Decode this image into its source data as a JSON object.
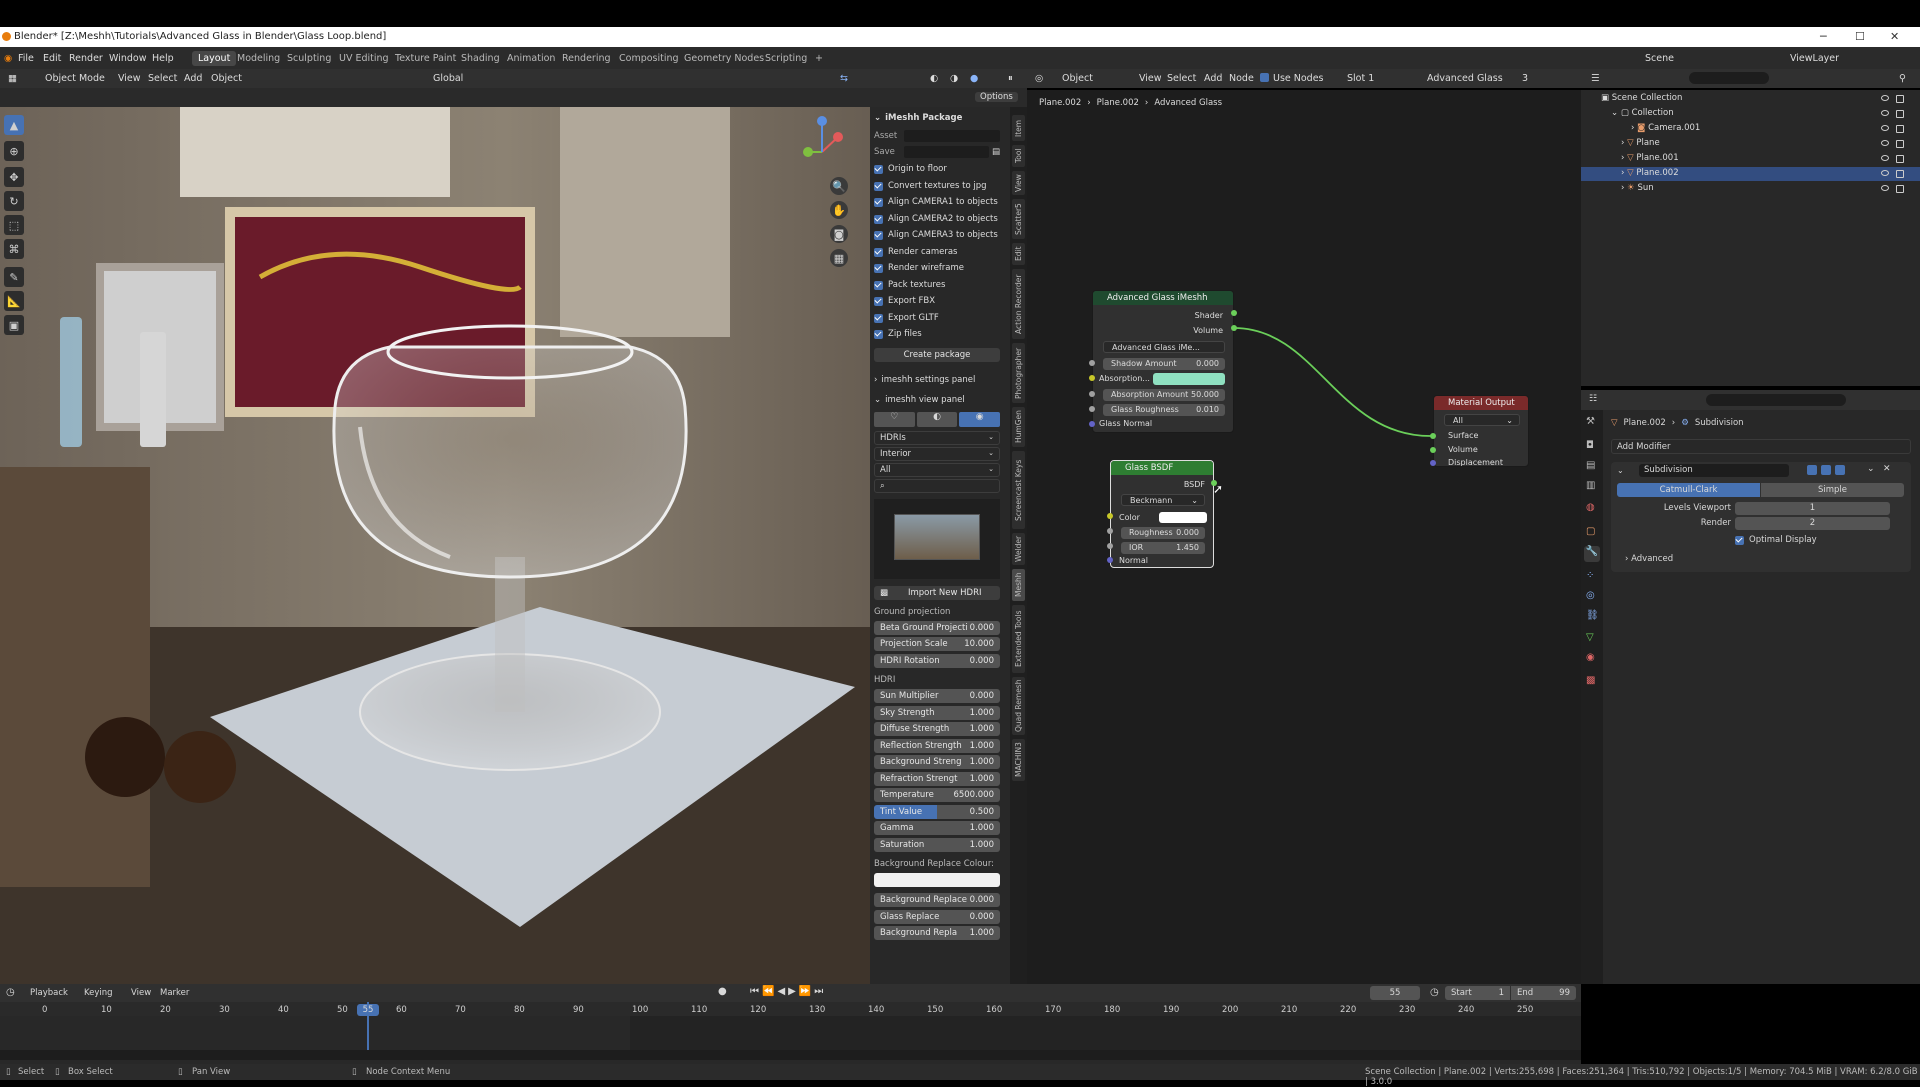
{
  "window": {
    "title": "Blender* [Z:\\Meshh\\Tutorials\\Advanced Glass in Blender\\Glass Loop.blend]"
  },
  "menubar": {
    "menus": [
      "File",
      "Edit",
      "Render",
      "Window",
      "Help"
    ],
    "workspaces": [
      "Layout",
      "Modeling",
      "Sculpting",
      "UV Editing",
      "Texture Paint",
      "Shading",
      "Animation",
      "Rendering",
      "Compositing",
      "Geometry Nodes",
      "Scripting"
    ],
    "add_tab": "+",
    "scene": "Scene",
    "view_layer": "ViewLayer"
  },
  "viewport_header": {
    "mode": "Object Mode",
    "menus": [
      "View",
      "Select",
      "Add",
      "Object"
    ],
    "orientation": "Global",
    "options": "Options"
  },
  "npanel": {
    "package_title": "iMeshh Package",
    "asset_label": "Asset",
    "save_label": "Save",
    "checkboxes": [
      "Origin to floor",
      "Convert textures to jpg",
      "Align CAMERA1 to objects",
      "Align CAMERA2 to objects",
      "Align CAMERA3 to objects",
      "Render cameras",
      "Render wireframe",
      "Pack textures",
      "Export FBX",
      "Export GLTF",
      "Zip files"
    ],
    "create_package": "Create package",
    "settings_panel": "imeshh settings panel",
    "view_panel": "imeshh view panel",
    "dropdowns": [
      "HDRIs",
      "Interior",
      "All"
    ],
    "import_hdri": "Import New HDRI",
    "ground_projection_label": "Ground projection",
    "ground_fields": [
      {
        "label": "Beta Ground Projecti",
        "value": "0.000"
      },
      {
        "label": "Projection Scale",
        "value": "10.000"
      },
      {
        "label": "HDRI Rotation",
        "value": "0.000"
      }
    ],
    "hdri_label": "HDRI",
    "hdri_fields": [
      {
        "label": "Sun Multiplier",
        "value": "0.000"
      },
      {
        "label": "Sky Strength",
        "value": "1.000"
      },
      {
        "label": "Diffuse Strength",
        "value": "1.000"
      },
      {
        "label": "Reflection Strength",
        "value": "1.000"
      },
      {
        "label": "Background Streng",
        "value": "1.000"
      },
      {
        "label": "Refraction Strengt",
        "value": "1.000"
      },
      {
        "label": "Temperature",
        "value": "6500.000"
      },
      {
        "label": "Tint Value",
        "value": "0.500"
      },
      {
        "label": "Gamma",
        "value": "1.000"
      },
      {
        "label": "Saturation",
        "value": "1.000"
      }
    ],
    "bg_replace_label": "Background Replace Colour:",
    "bg_fields": [
      {
        "label": "Background Replace",
        "value": "0.000"
      },
      {
        "label": "Glass Replace",
        "value": "0.000"
      },
      {
        "label": "Background Repla",
        "value": "1.000"
      }
    ]
  },
  "vtabs": [
    "Item",
    "Tool",
    "View",
    "Scatter5",
    "Edit",
    "Action Recorder",
    "Photographer",
    "HumGen",
    "Screencast Keys",
    "Welder",
    "Meshh",
    "Extended Tools",
    "Quad Remesh",
    "MACHIN3"
  ],
  "node_header": {
    "object": "Object",
    "menus": [
      "View",
      "Select",
      "Add",
      "Node"
    ],
    "use_nodes": "Use Nodes",
    "slot": "Slot 1",
    "material": "Advanced Glass",
    "users": "3",
    "breadcrumb": [
      "Plane.002",
      "Plane.002",
      "Advanced Glass"
    ]
  },
  "nodes": {
    "group": {
      "title": "Advanced Glass iMeshh",
      "out_shader": "Shader",
      "out_volume": "Volume",
      "datablock": "Advanced Glass iMe...",
      "shadow_amount": "Shadow Amount",
      "shadow_value": "0.000",
      "absorption": "Absorption...",
      "absorption_amount": "Absorption Amount",
      "absorption_amount_value": "50.000",
      "glass_roughness": "Glass Roughness",
      "glass_roughness_value": "0.010",
      "glass_normal": "Glass Normal"
    },
    "bsdf": {
      "title": "Glass BSDF",
      "out": "BSDF",
      "distribution": "Beckmann",
      "color": "Color",
      "roughness": "Roughness",
      "roughness_value": "0.000",
      "ior": "IOR",
      "ior_value": "1.450",
      "normal": "Normal"
    },
    "output": {
      "title": "Material Output",
      "target": "All",
      "surface": "Surface",
      "volume": "Volume",
      "displacement": "Displacement"
    }
  },
  "outliner": {
    "scene_collection": "Scene Collection",
    "items": [
      "Collection",
      "Camera.001",
      "Plane",
      "Plane.001",
      "Plane.002",
      "Sun"
    ]
  },
  "properties": {
    "object": "Plane.002",
    "modifier_tab": "Subdivision",
    "add_modifier": "Add Modifier",
    "modifier_name": "Subdivision",
    "mode_a": "Catmull-Clark",
    "mode_b": "Simple",
    "levels_viewport_label": "Levels Viewport",
    "levels_viewport": "1",
    "render_label": "Render",
    "render": "2",
    "optimal_display": "Optimal Display",
    "advanced": "Advanced"
  },
  "timeline": {
    "menus": [
      "Playback",
      "Keying",
      "View",
      "Marker"
    ],
    "current_frame": "55",
    "start_label": "Start",
    "start": "1",
    "end_label": "End",
    "end": "99",
    "ticks": [
      "0",
      "10",
      "20",
      "30",
      "40",
      "50",
      "60",
      "70",
      "80",
      "90",
      "100",
      "110",
      "120",
      "130",
      "140",
      "150",
      "160",
      "170",
      "180",
      "190",
      "200",
      "210",
      "220",
      "230",
      "240",
      "250"
    ]
  },
  "statusbar": {
    "select": "Select",
    "box_select": "Box Select",
    "pan_view": "Pan View",
    "node_context": "Node Context Menu",
    "info": "Scene Collection | Plane.002 | Verts:255,698 | Faces:251,364 | Tris:510,792 | Objects:1/5 | Memory: 704.5 MiB | VRAM: 6.2/8.0 GiB | 3.0.0"
  },
  "colors": {
    "accent_blue": "#4772b3",
    "absorption_swatch": "#8fe0c0",
    "node_group_header": "#1f4a2f",
    "shader_header": "#2e7d32",
    "output_header": "#7a2a2a",
    "link_green": "#6bcf5a"
  }
}
